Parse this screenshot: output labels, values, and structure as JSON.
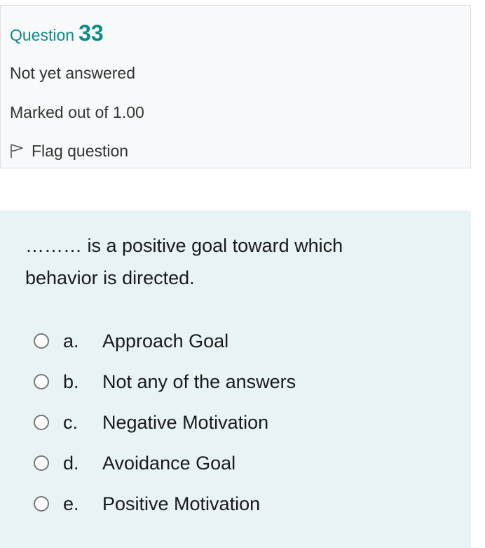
{
  "question_info": {
    "label": "Question",
    "number": "33",
    "state": "Not yet answered",
    "grade": "Marked out of 1.00",
    "flag_label": "Flag question"
  },
  "question": {
    "text": "……… is a positive goal toward which behavior is directed.",
    "options": [
      {
        "letter": "a.",
        "label": "Approach Goal"
      },
      {
        "letter": "b.",
        "label": "Not any of the answers"
      },
      {
        "letter": "c.",
        "label": "Negative Motivation"
      },
      {
        "letter": "d.",
        "label": "Avoidance Goal"
      },
      {
        "letter": "e.",
        "label": "Positive Motivation"
      }
    ]
  },
  "colors": {
    "accent": "#0f8a8a",
    "info_bg": "#f7f9fa",
    "formulation_bg": "#e7f3f5"
  }
}
